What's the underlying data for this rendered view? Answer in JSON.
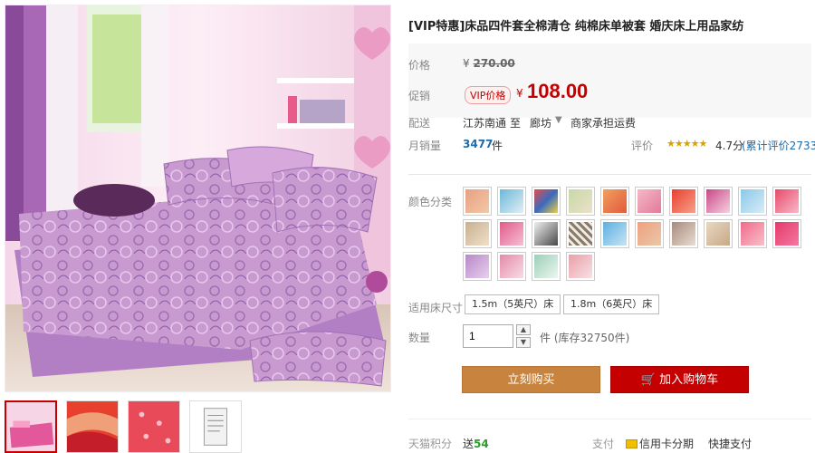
{
  "product": {
    "title": "[VIP特惠]床品四件套全棉清仓 纯棉床单被套 婚庆床上用品家纺"
  },
  "price": {
    "label": "价格",
    "currency": "¥",
    "original": "270.00",
    "promo_label": "促销",
    "vip_tag": "VIP价格",
    "promo_currency": "¥",
    "promo_price": "108.00"
  },
  "shipping": {
    "label": "配送",
    "from": "江苏南通",
    "to_word": "至",
    "destination": "廊坊",
    "note": "商家承担运费"
  },
  "sales": {
    "label": "月销量",
    "count": "3477",
    "unit": "件",
    "rating_label": "评价",
    "stars": "★★★★★",
    "score": "4.7分",
    "review_text": "(累计评价2733)"
  },
  "options": {
    "color_label": "颜色分类",
    "size_label": "适用床尺寸",
    "sizes": [
      "1.5m（5英尺）床",
      "1.8m（6英尺）床"
    ]
  },
  "quantity": {
    "label": "数量",
    "value": "1",
    "up": "▲",
    "down": "▼",
    "stock_text": "件 (库存32750件)"
  },
  "actions": {
    "buy_now": "立刻购买",
    "add_to_cart": "加入购物车"
  },
  "footer": {
    "points_label": "天猫积分",
    "points_prefix": "送",
    "points_value": "54",
    "payment_label": "支付",
    "credit": "信用卡分期",
    "quick_pay": "快捷支付"
  }
}
